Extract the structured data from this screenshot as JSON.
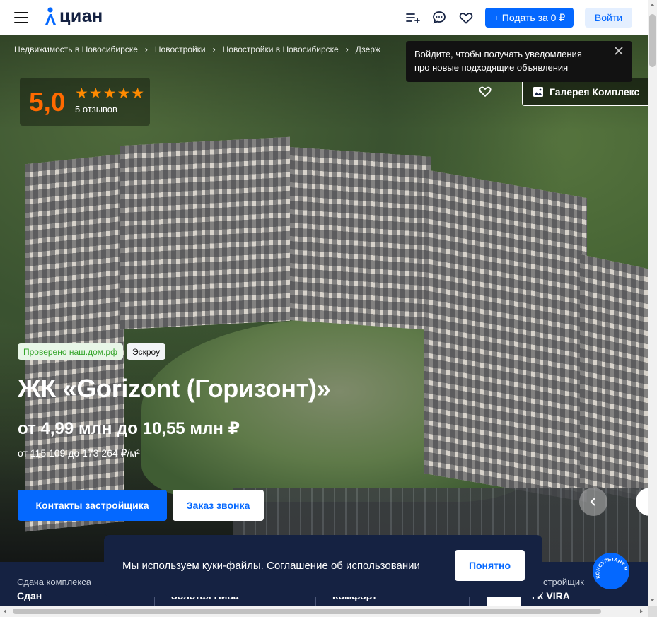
{
  "header": {
    "logo_text": "циан",
    "submit_label": "+ Подать за 0 ₽",
    "login_label": "Войти",
    "brand_color": "#0468ff",
    "icons": [
      "menu-icon",
      "saved-searches-icon",
      "chat-icon",
      "heart-icon"
    ]
  },
  "breadcrumbs": [
    "Недвижимость в Новосибирске",
    "Новостройки",
    "Новостройки в Новосибирске",
    "Дзерж"
  ],
  "tooltip": {
    "text_line1": "Войдите, чтобы получать уведомления",
    "text_line2": "про новые подходящие объявления"
  },
  "rating": {
    "value": "5,0",
    "stars": "★★★★★",
    "reviews": "5 отзывов"
  },
  "gallery_label": "Галерея Комплекс",
  "badges": {
    "verified": "Проверено наш.дом.рф",
    "escrow": "Эскроу"
  },
  "complex": {
    "title": "ЖК «Gorizont (Горизонт)»",
    "price": "от 4,99 млн до 10,55 млн ₽",
    "price_per_m2": "от 115 109 до 173 264 ₽/м²"
  },
  "actions": {
    "contacts_label": "Контакты застройщика",
    "call_label": "Заказ звонка"
  },
  "strip": {
    "label1": "Сдача комплекса",
    "value1": "Сдан",
    "value2": "Золотая Нива",
    "value3": "Комфорт",
    "label4": "стройщик",
    "value4": "ГК VIRA"
  },
  "cookie": {
    "text": "Мы используем куки-файлы.",
    "link": "Соглашение об использовании",
    "button": "Понятно"
  },
  "chat_widget": {
    "label": "КОНСУЛЬТАНТ ЧАТ"
  }
}
